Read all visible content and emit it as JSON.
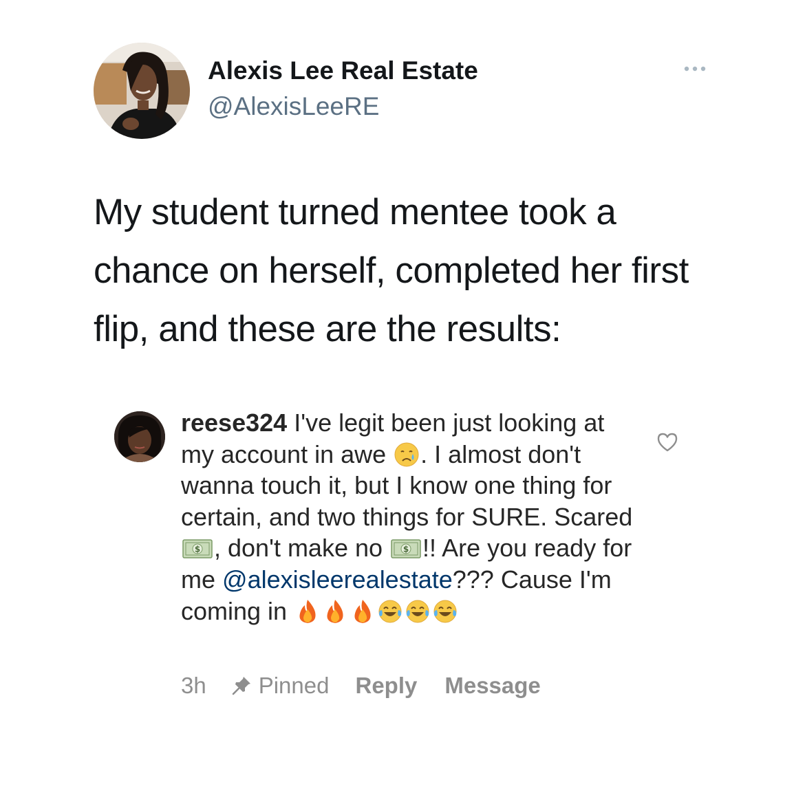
{
  "tweet": {
    "author_name": "Alexis Lee Real Estate",
    "author_handle": "@AlexisLeeRE",
    "text": "My student turned mentee took a chance on herself, completed her first flip, and these are the results:"
  },
  "comment": {
    "username": "reese324",
    "text_1": "I've legit been just looking at my account in awe",
    "text_2": ". I almost don't wanna touch it, but I know one thing for certain, and two things for SURE. Scared",
    "text_3": ", don't make no",
    "text_4": "!! Are you ready for me",
    "mention": "@alexisleerealestate",
    "text_5": "??? Cause I'm coming in",
    "time": "3h",
    "pinned_label": "Pinned",
    "reply_label": "Reply",
    "message_label": "Message"
  },
  "icons": {
    "more": "more-options-icon",
    "heart": "heart-outline-icon",
    "pin": "pin-icon",
    "emoji_crying": "crying-face-emoji",
    "emoji_money": "dollar-bill-emoji",
    "emoji_fire": "fire-emoji",
    "emoji_laughing": "tears-of-joy-emoji"
  },
  "colors": {
    "handle": "#5b7083",
    "mention": "#00376b",
    "meta": "#8e8e8e"
  }
}
